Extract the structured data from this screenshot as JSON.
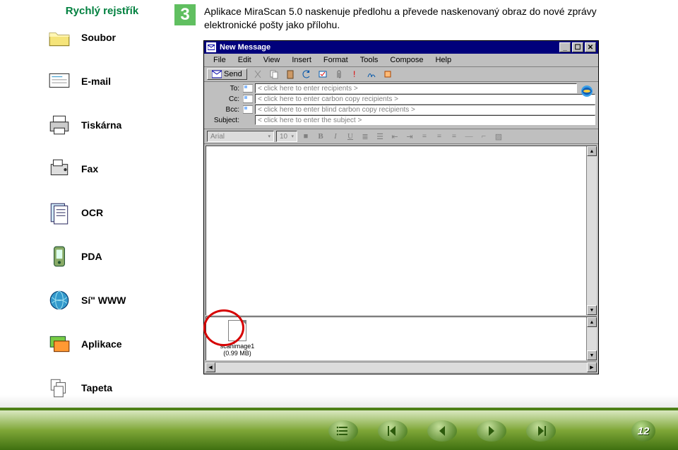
{
  "sidebar": {
    "title": "Rychlý rejstřík",
    "items": [
      {
        "label": "Soubor",
        "name": "sidebar-item-soubor",
        "icon": "folder-icon"
      },
      {
        "label": "E-mail",
        "name": "sidebar-item-email",
        "icon": "email-icon"
      },
      {
        "label": "Tiskárna",
        "name": "sidebar-item-tiskarna",
        "icon": "printer-icon"
      },
      {
        "label": "Fax",
        "name": "sidebar-item-fax",
        "icon": "fax-icon"
      },
      {
        "label": "OCR",
        "name": "sidebar-item-ocr",
        "icon": "ocr-icon"
      },
      {
        "label": "PDA",
        "name": "sidebar-item-pda",
        "icon": "pda-icon"
      },
      {
        "label": "Sí\" WWW",
        "name": "sidebar-item-www",
        "icon": "globe-icon"
      },
      {
        "label": "Aplikace",
        "name": "sidebar-item-aplikace",
        "icon": "apps-icon"
      },
      {
        "label": "Tapeta",
        "name": "sidebar-item-tapeta",
        "icon": "wallpaper-icon"
      }
    ]
  },
  "step": {
    "num": "3"
  },
  "instruction": "Aplikace MiraScan 5.0 naskenuje předlohu a převede naskenovaný obraz do nové zprávy elektronické pošty jako přílohu.",
  "emailwin": {
    "title": "New Message",
    "menu": [
      "File",
      "Edit",
      "View",
      "Insert",
      "Format",
      "Tools",
      "Compose",
      "Help"
    ],
    "send_label": "Send",
    "headers": {
      "to": {
        "label": "To:",
        "ph": "< click here to enter recipients >"
      },
      "cc": {
        "label": "Cc:",
        "ph": "< click here to enter carbon copy recipients >"
      },
      "bcc": {
        "label": "Bcc:",
        "ph": "< click here to enter blind carbon copy recipients >"
      },
      "subject": {
        "label": "Subject:",
        "ph": "< click here to enter the subject >"
      }
    },
    "format": {
      "font": "Arial",
      "size": "10"
    },
    "attachment": {
      "name": "scanimage1",
      "size": "(0.99 MB)"
    }
  },
  "footer": {
    "page": "12"
  },
  "colors": {
    "accent": "#00803f",
    "stepbg": "#60bf60",
    "titlebar": "#00007b"
  }
}
